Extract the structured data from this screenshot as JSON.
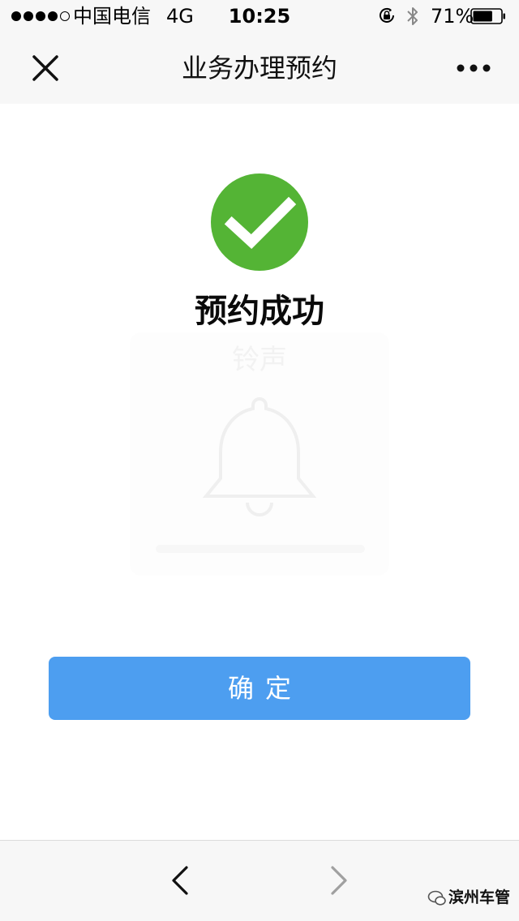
{
  "status_bar": {
    "carrier": "中国电信",
    "network": "4G",
    "time": "10:25",
    "battery_percent": "71%",
    "battery_level": 0.71,
    "signal_bars_filled": 4,
    "signal_bars_total": 5
  },
  "nav": {
    "title": "业务办理预约",
    "close_icon": "close-icon",
    "more_icon": "more-icon"
  },
  "result": {
    "icon": "check-icon",
    "icon_color": "#54b435",
    "message": "预约成功"
  },
  "watermark_card": {
    "text": "铃声",
    "icon": "bell-icon"
  },
  "confirm": {
    "label": "确定",
    "color": "#4d9ef0"
  },
  "bottom_bar": {
    "back_icon": "chevron-left-icon",
    "forward_icon": "chevron-right-icon",
    "watermark_text": "滨州车管"
  }
}
